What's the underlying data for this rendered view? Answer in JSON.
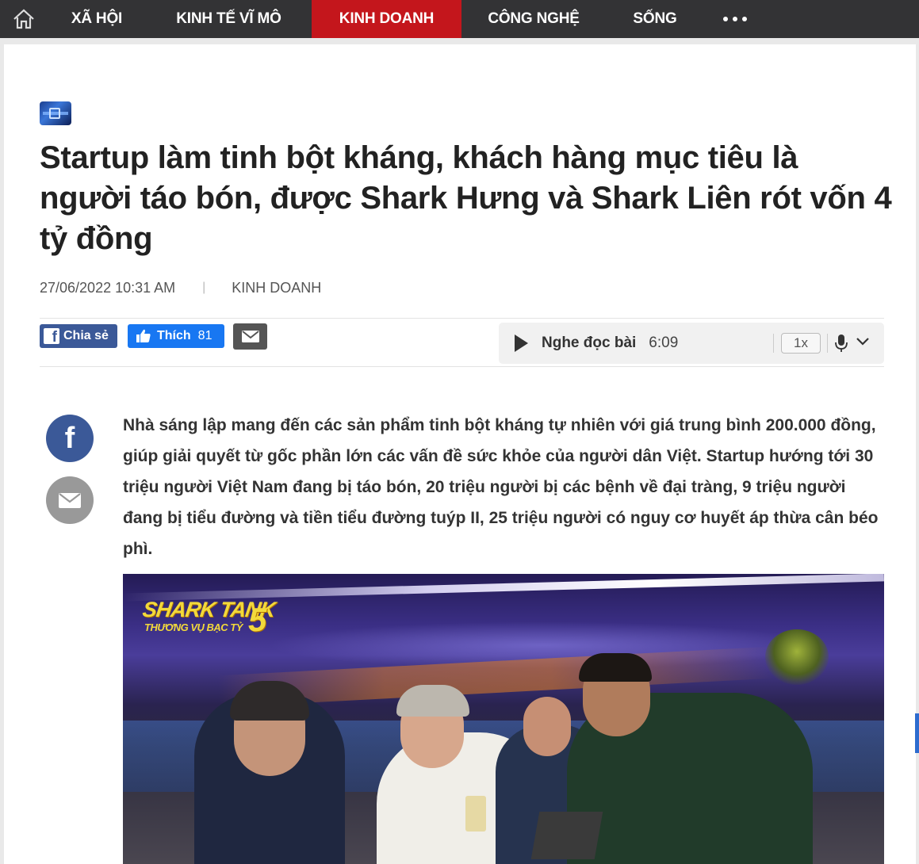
{
  "nav": {
    "home_icon": "home-icon",
    "items": [
      {
        "label": "XÃ HỘI",
        "active": false
      },
      {
        "label": "KINH TẾ VĨ MÔ",
        "active": false
      },
      {
        "label": "KINH DOANH",
        "active": true
      },
      {
        "label": "CÔNG NGHỆ",
        "active": false
      },
      {
        "label": "SỐNG",
        "active": false
      }
    ],
    "more_icon": "more-dots-icon",
    "active_color": "#c4161c",
    "bar_color": "#333335"
  },
  "article": {
    "title": "Startup làm tinh bột kháng, khách hàng mục tiêu là người táo bón, được Shark Hưng và Shark Liên rót vốn 4 tỷ đồng",
    "date": "27/06/2022 10:31 AM",
    "separator": "|",
    "category": "KINH DOANH",
    "lead": "Nhà sáng lập mang đến các sản phẩm tinh bột kháng tự nhiên với giá trung bình 200.000 đồng, giúp giải quyết từ gốc phần lớn các vấn đề sức khỏe của người dân Việt. Startup hướng tới 30 triệu người Việt Nam đang bị táo bón, 20 triệu người bị các bệnh về đại tràng, 9 triệu người đang bị tiểu đường và tiền tiểu đường tuýp II, 25 triệu người có nguy cơ huyết áp thừa cân béo phì."
  },
  "share": {
    "fb_label": "Chia sẻ",
    "like_label": "Thích",
    "like_count": "81"
  },
  "audio": {
    "label": "Nghe đọc bài",
    "duration": "6:09",
    "speed": "1x"
  },
  "photo": {
    "logo_line1": "SHARK TANK",
    "logo_line2": "THƯƠNG VỤ BẠC TỶ",
    "logo_number": "5"
  }
}
